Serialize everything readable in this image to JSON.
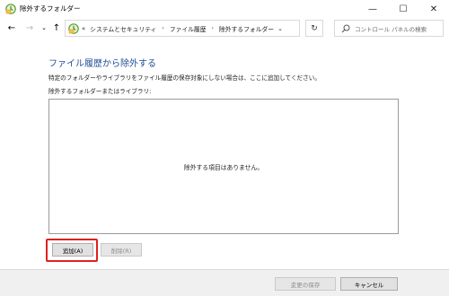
{
  "window": {
    "title": "除外するフォルダー",
    "minimize_glyph": "—",
    "maximize_glyph": "☐",
    "close_glyph": "✕"
  },
  "nav": {
    "back_glyph": "←",
    "forward_glyph": "→",
    "recent_glyph": "⌄",
    "up_glyph": "↑"
  },
  "address": {
    "overflow_glyph": "«",
    "crumbs": [
      "システムとセキュリティ",
      "ファイル履歴",
      "除外するフォルダー"
    ],
    "separator": "›",
    "dropdown_glyph": "⌄",
    "refresh_glyph": "↻"
  },
  "search": {
    "placeholder": "コントロール パネルの検索"
  },
  "main": {
    "heading": "ファイル履歴から除外する",
    "description": "特定のフォルダーやライブラリをファイル履歴の保存対象にしない場合は、ここに追加してください。",
    "list_label": "除外するフォルダーまたはライブラリ:",
    "empty_message": "除外する項目はありません。"
  },
  "buttons": {
    "add": "追加(A)",
    "remove": "削除(R)",
    "save": "変更の保存",
    "cancel": "キャンセル"
  },
  "colors": {
    "heading": "#1e4e95",
    "highlight": "#e02020"
  }
}
